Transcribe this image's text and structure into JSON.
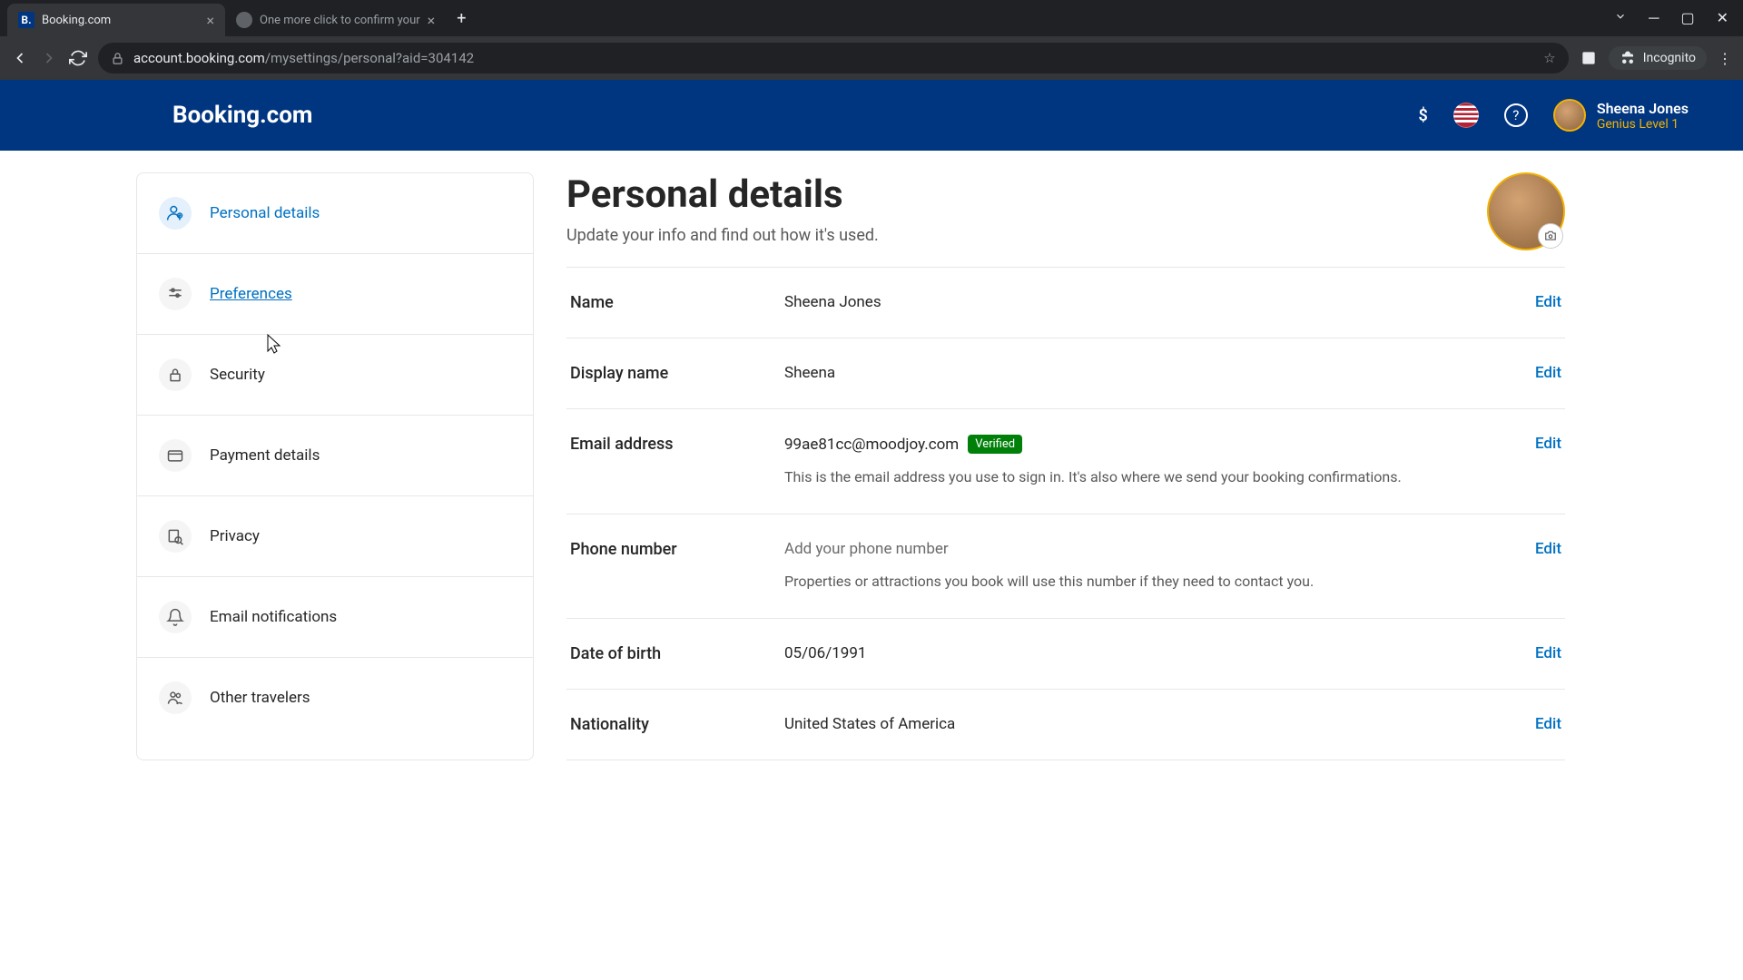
{
  "browser": {
    "tabs": [
      {
        "title": "Booking.com",
        "favicon": "B."
      },
      {
        "title": "One more click to confirm your"
      }
    ],
    "url_host": "account.booking.com",
    "url_path": "/mysettings/personal?aid=304142",
    "incognito_label": "Incognito"
  },
  "header": {
    "logo": "Booking.com",
    "currency": "$",
    "user_name": "Sheena Jones",
    "user_level": "Genius Level 1"
  },
  "sidebar": {
    "items": [
      {
        "label": "Personal details"
      },
      {
        "label": "Preferences"
      },
      {
        "label": "Security"
      },
      {
        "label": "Payment details"
      },
      {
        "label": "Privacy"
      },
      {
        "label": "Email notifications"
      },
      {
        "label": "Other travelers"
      }
    ]
  },
  "main": {
    "title": "Personal details",
    "subtitle": "Update your info and find out how it's used.",
    "edit_label": "Edit",
    "verified_label": "Verified",
    "rows": {
      "name": {
        "label": "Name",
        "value": "Sheena Jones"
      },
      "display_name": {
        "label": "Display name",
        "value": "Sheena"
      },
      "email": {
        "label": "Email address",
        "value": "99ae81cc@moodjoy.com",
        "help": "This is the email address you use to sign in. It's also where we send your booking confirmations."
      },
      "phone": {
        "label": "Phone number",
        "placeholder": "Add your phone number",
        "help": "Properties or attractions you book will use this number if they need to contact you."
      },
      "dob": {
        "label": "Date of birth",
        "value": "05/06/1991"
      },
      "nationality": {
        "label": "Nationality",
        "value": "United States of America"
      }
    }
  }
}
